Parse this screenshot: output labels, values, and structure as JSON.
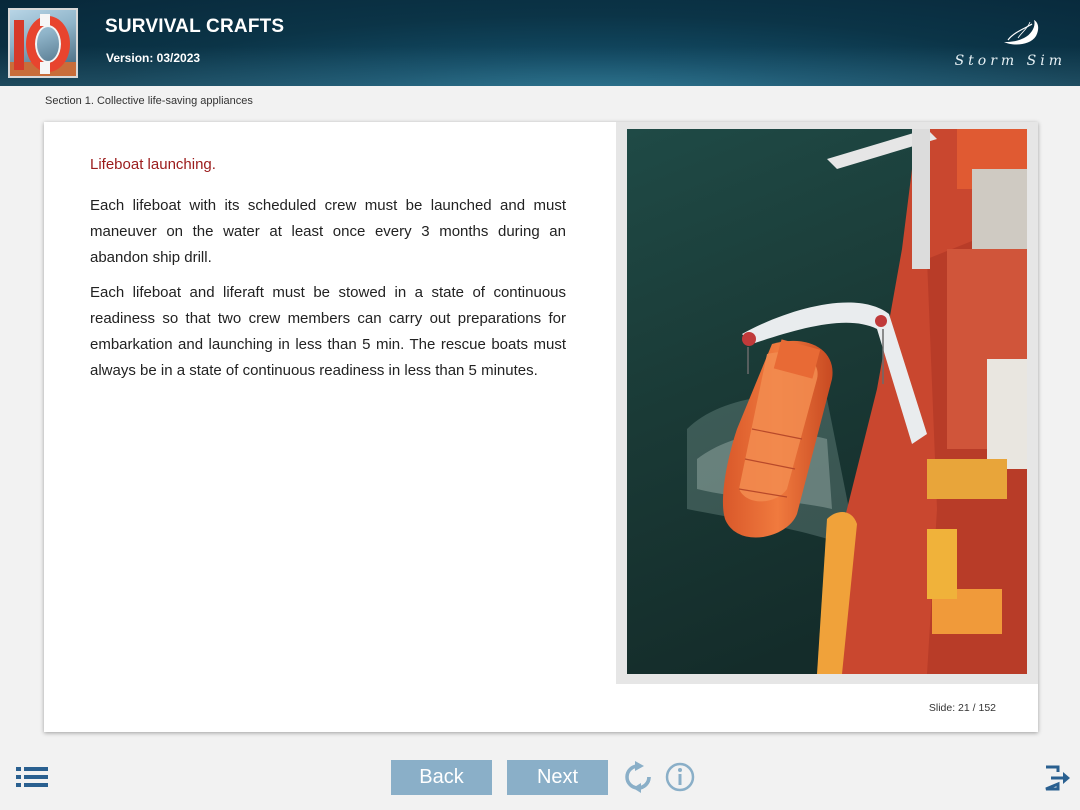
{
  "header": {
    "title": "SURVIVAL CRAFTS",
    "version": "Version: 03/2023",
    "logo_text": "Storm Sim"
  },
  "breadcrumb": "Section 1. Collective life-saving appliances",
  "slide": {
    "subtitle": "Lifeboat launching.",
    "paragraphs": [
      "Each lifeboat with its scheduled crew must be launched and must maneuver on the water at least once every 3 months during an abandon ship drill.",
      "Each lifeboat and liferaft must be stowed in a state of continuous readiness so that two crew members can carry out preparations for embarkation and launching in less than 5 min. The rescue boats must always be in a state of continuous readiness in less than 5 minutes."
    ],
    "counter_label": "Slide:",
    "counter_value": "21 / 152"
  },
  "nav": {
    "back_label": "Back",
    "next_label": "Next"
  },
  "icons": {
    "menu": "list-menu-icon",
    "reload": "reload-icon",
    "info": "info-icon",
    "exit": "exit-icon"
  },
  "colors": {
    "accent_button": "#8aafc8",
    "subtitle_red": "#9b1b1b",
    "header_dark": "#0b3447"
  }
}
